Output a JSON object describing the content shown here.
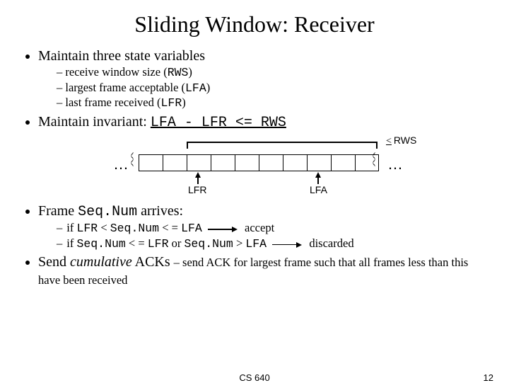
{
  "title": "Sliding Window: Receiver",
  "b1": {
    "text": "Maintain three state variables",
    "sub": {
      "a": "receive window size (",
      "a_code": "RWS",
      "a_end": ")",
      "b": "largest frame acceptable (",
      "b_code": "LFA",
      "b_end": ")",
      "c": "last frame received (",
      "c_code": "LFR",
      "c_end": ")"
    }
  },
  "b2": {
    "text": "Maintain invariant: ",
    "code": "LFA - LFR <= RWS"
  },
  "diagram": {
    "rws_le": "<",
    "rws": "RWS",
    "dots": "…",
    "lfr": "LFR",
    "lfa": "LFA"
  },
  "b3": {
    "prefix": "Frame ",
    "code": "Seq.Num",
    "suffix": " arrives:",
    "sub": {
      "a_prefix": "if ",
      "a_code1": "LFR",
      "a_mid1": " < ",
      "a_code2": "Seq.Num",
      "a_mid2": " < = ",
      "a_code3": "LFA",
      "a_action": "accept",
      "b_prefix": "if ",
      "b_code1": "Seq.Num",
      "b_mid1": " < = ",
      "b_code2": "LFR",
      "b_mid2": " or ",
      "b_code3": "Seq.Num",
      "b_mid3": " > ",
      "b_code4": "LFA",
      "b_action": "discarded"
    }
  },
  "b4": {
    "prefix": "Send ",
    "emph": "cumulative",
    "mid": " ACKs ",
    "note": "– send ACK for largest frame such that all frames less than this have been received"
  },
  "footer": {
    "course": "CS 640",
    "page": "12"
  }
}
